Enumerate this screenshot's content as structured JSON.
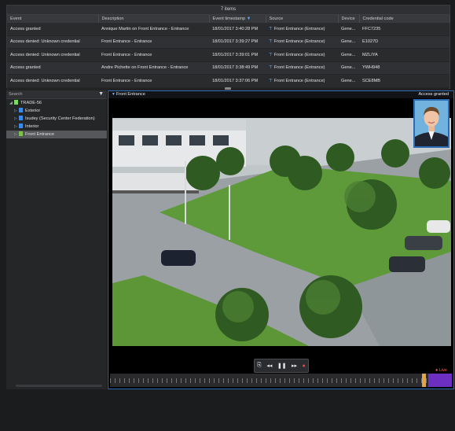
{
  "event_panel": {
    "count_label": "7 items",
    "columns": [
      "Event",
      "Description",
      "Event timestamp",
      "Source",
      "Device",
      "Credential code"
    ],
    "sort_marker": "▼",
    "rows": [
      [
        "Access granted",
        "Annique Martin on Front Entrance - Entrance",
        "18/01/2017 3:40:28 PM",
        "Front Entrance (Entrance)",
        "Gene...",
        "FFC7235"
      ],
      [
        "Access denied: Unknown credential",
        "Front Entrance - Entrance",
        "18/01/2017 3:39:27 PM",
        "Front Entrance (Entrance)",
        "Gene...",
        "E1027D"
      ],
      [
        "Access denied: Unknown credential",
        "Front Entrance - Entrance",
        "18/01/2017 3:39:01 PM",
        "Front Entrance (Entrance)",
        "Gene...",
        "MZLIYA"
      ],
      [
        "Access granted",
        "Andre Pichette on Front Entrance - Entrance",
        "18/01/2017 3:38:49 PM",
        "Front Entrance (Entrance)",
        "Gene...",
        "YWH948"
      ],
      [
        "Access denied: Unknown credential",
        "Front Entrance - Entrance",
        "18/01/2017 3:37:06 PM",
        "Front Entrance (Entrance)",
        "Gene...",
        "SCE8MB"
      ]
    ]
  },
  "tree": {
    "search_placeholder": "Search",
    "items": [
      {
        "label": "TRADE-56",
        "level": 0,
        "expander": "◢",
        "icon_color": "#7bdc63",
        "selected": false
      },
      {
        "label": "Exterior",
        "level": 1,
        "expander": "▷",
        "icon_color": "#3c8be6",
        "selected": false
      },
      {
        "label": "Isudey (Security Center Federation)",
        "level": 1,
        "expander": "▷",
        "icon_color": "#3c8be6",
        "selected": false
      },
      {
        "label": "Interior",
        "level": 1,
        "expander": "▷",
        "icon_color": "#3c8be6",
        "selected": false
      },
      {
        "label": "Front Entrance",
        "level": 1,
        "expander": "▷",
        "icon_color": "#7ec04d",
        "selected": true
      }
    ]
  },
  "tile": {
    "camera_label": "Front Entrance",
    "status_label": "Access granted",
    "live_label": "● Live",
    "controls": [
      "⎘",
      "◂◂",
      "❚❚",
      "▸▸",
      "●"
    ],
    "border_color": "#2b6cb5"
  }
}
